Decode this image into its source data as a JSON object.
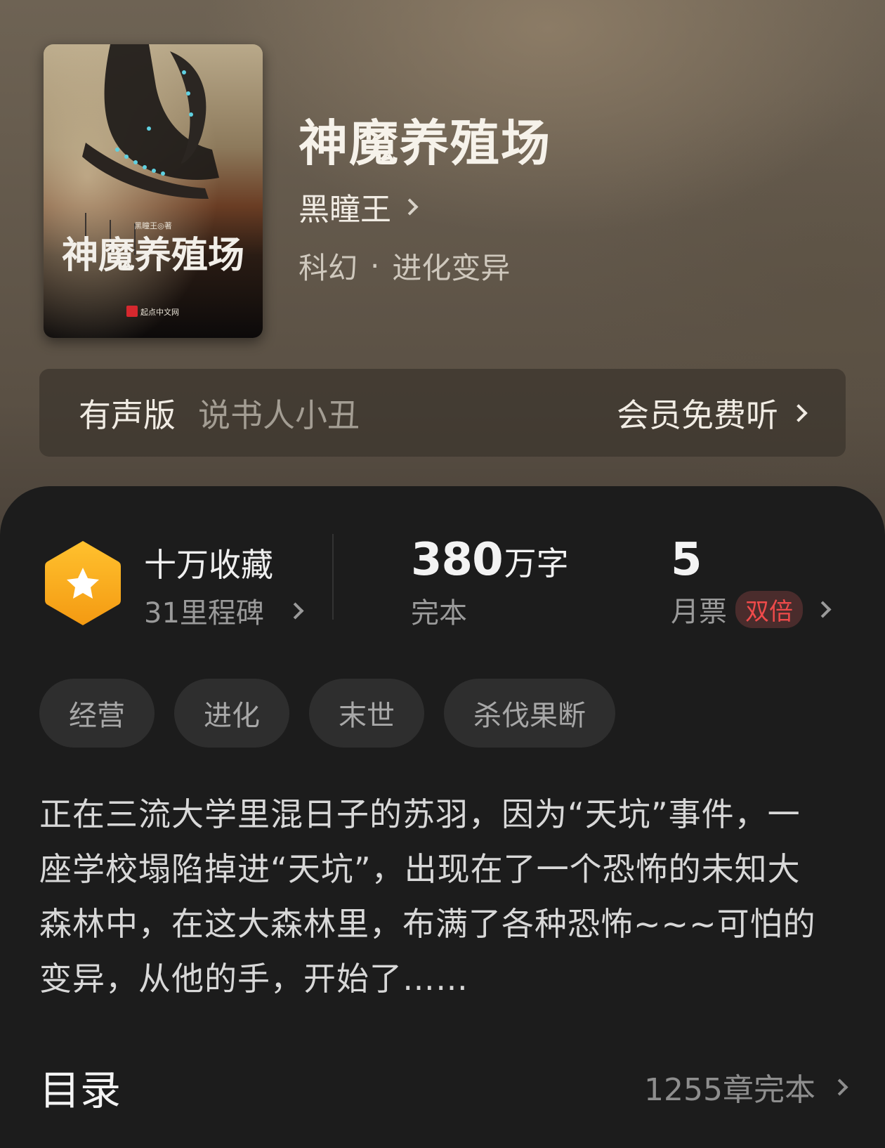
{
  "book": {
    "title": "神魔养殖场",
    "author": "黑瞳王",
    "genre_primary": "科幻",
    "genre_separator": "·",
    "genre_secondary": "进化变异",
    "cover": {
      "title": "神魔养殖场",
      "byline": "黑瞳王◎著",
      "publisher": "起点中文网"
    }
  },
  "audio": {
    "label": "有声版",
    "narrator": "说书人小丑",
    "cta": "会员免费听"
  },
  "stats": {
    "collections": "十万收藏",
    "milestones": "31里程碑",
    "word_count": "380",
    "word_unit": "万字",
    "status": "完本",
    "monthly_tickets": "5",
    "monthly_label": "月票",
    "double_badge": "双倍"
  },
  "tags": [
    "经营",
    "进化",
    "末世",
    "杀伐果断"
  ],
  "synopsis": "正在三流大学里混日子的苏羽，因为“天坑”事件，一座学校塌陷掉进“天坑”，出现在了一个恐怖的未知大森林中，在这大森林里，布满了各种恐怖~~~可怕的变异，从他的手，开始了……",
  "toc": {
    "title": "目录",
    "count": "1255章完本"
  },
  "colors": {
    "accent_badge": "#f7a21a",
    "double_badge_text": "#ef4a4a",
    "panel_bg": "#1c1c1c"
  }
}
